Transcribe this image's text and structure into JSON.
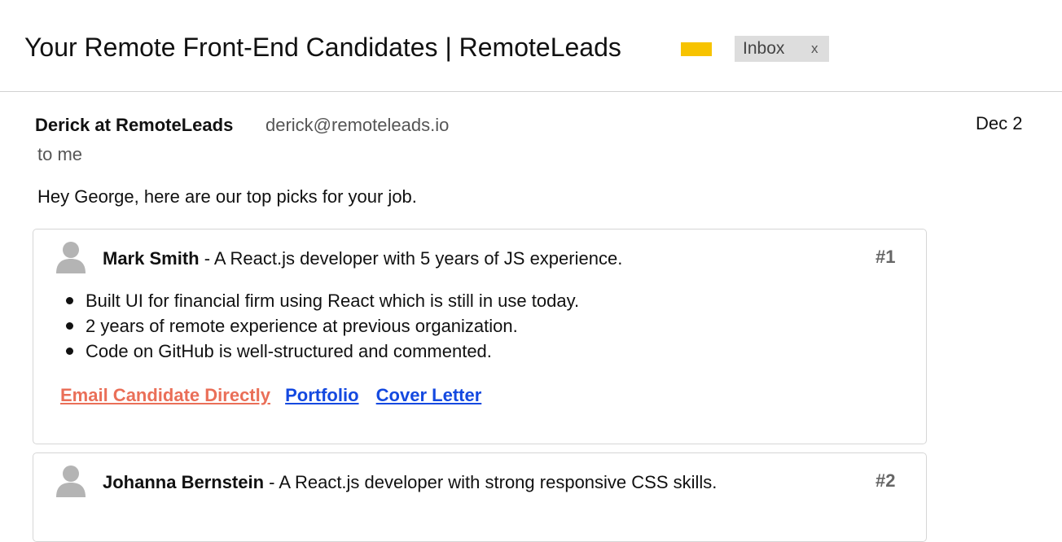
{
  "email": {
    "subject": "Your Remote Front-End Candidates | RemoteLeads",
    "label_color": "#f7c300",
    "inbox_chip": {
      "label": "Inbox",
      "close": "x"
    },
    "sender": {
      "name": "Derick at RemoteLeads",
      "email": "derick@remoteleads.io"
    },
    "date": "Dec 2",
    "recipient": "to me",
    "greeting": "Hey George, here are our top picks for your job."
  },
  "candidates": [
    {
      "name": "Mark Smith",
      "summary": " - A React.js developer with 5 years of JS experience.",
      "rank": "#1",
      "avatar_icon": "person-silhouette-icon",
      "highlights": [
        "Built UI for financial firm using React which is still in use today.",
        "2 years of remote experience at previous organization.",
        "Code on GitHub is well-structured and commented."
      ],
      "links": {
        "email": "Email Candidate Directly",
        "portfolio": "Portfolio",
        "cover_letter": "Cover Letter"
      }
    },
    {
      "name": "Johanna Bernstein",
      "summary": " - A React.js developer with strong responsive CSS skills.",
      "rank": "#2",
      "avatar_icon": "person-silhouette-icon"
    }
  ],
  "colors": {
    "email_link": "#ea6f58",
    "link": "#1449e0"
  }
}
